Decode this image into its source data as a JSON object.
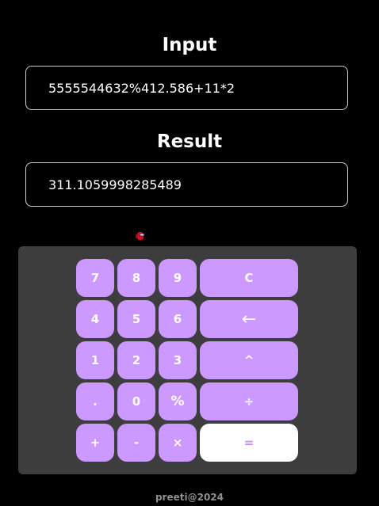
{
  "input": {
    "title": "Input",
    "value": "5555544632%412.586+11*2"
  },
  "result": {
    "title": "Result",
    "value": "311.1059998285489"
  },
  "keypad": {
    "keys": {
      "seven": "7",
      "eight": "8",
      "nine": "9",
      "clear": "C",
      "four": "4",
      "five": "5",
      "six": "6",
      "backspace": "←",
      "one": "1",
      "two": "2",
      "three": "3",
      "power": "^",
      "dot": ".",
      "zero": "0",
      "percent": "%",
      "divide": "÷",
      "plus": "+",
      "minus": "-",
      "multiply": "×",
      "equals": "="
    }
  },
  "footer": {
    "text": "preeti@2024"
  },
  "colors": {
    "background": "#000000",
    "keypad_bg": "#3d3d3d",
    "key": "#cb99ff",
    "equals_bg": "#ffffff",
    "equals_text": "#c58cff",
    "footer_text": "#8f8f8f"
  },
  "decorations": {
    "icon": "red-crewmate-icon"
  }
}
